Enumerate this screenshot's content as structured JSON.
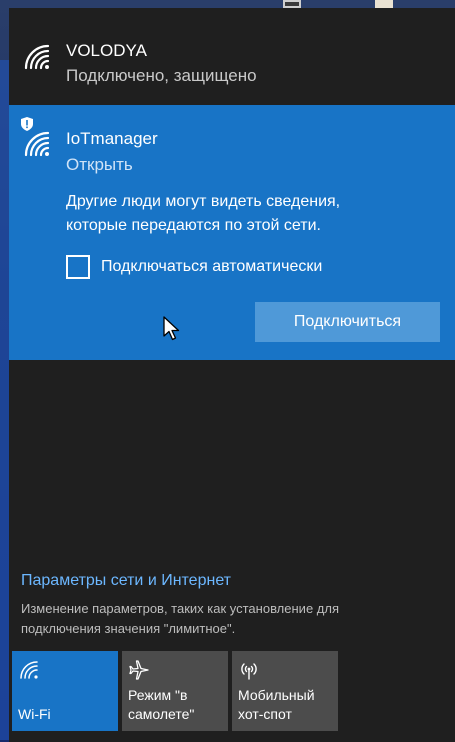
{
  "networks": [
    {
      "ssid": "VOLODYA",
      "status": "Подключено, защищено"
    },
    {
      "ssid": "IoTmanager",
      "status": "Открыть",
      "warning": "Другие люди могут видеть сведения, которые передаются по этой сети.",
      "auto_connect_label": "Подключаться автоматически",
      "auto_connect_checked": false,
      "connect_label": "Подключиться"
    }
  ],
  "settings": {
    "link": "Параметры сети и Интернет",
    "description": "Изменение параметров, таких как установление для подключения значения \"лимитное\"."
  },
  "quick_actions": [
    {
      "label": "Wi-Fi",
      "icon": "wifi-icon",
      "active": true
    },
    {
      "label": "Режим \"в самолете\"",
      "icon": "airplane-icon",
      "active": false
    },
    {
      "label": "Мобильный хот-спот",
      "icon": "hotspot-icon",
      "active": false
    }
  ],
  "colors": {
    "accent": "#1874c6",
    "link": "#6cb7ff",
    "panel": "#1f1f1f",
    "tile": "#4c4c4c"
  }
}
